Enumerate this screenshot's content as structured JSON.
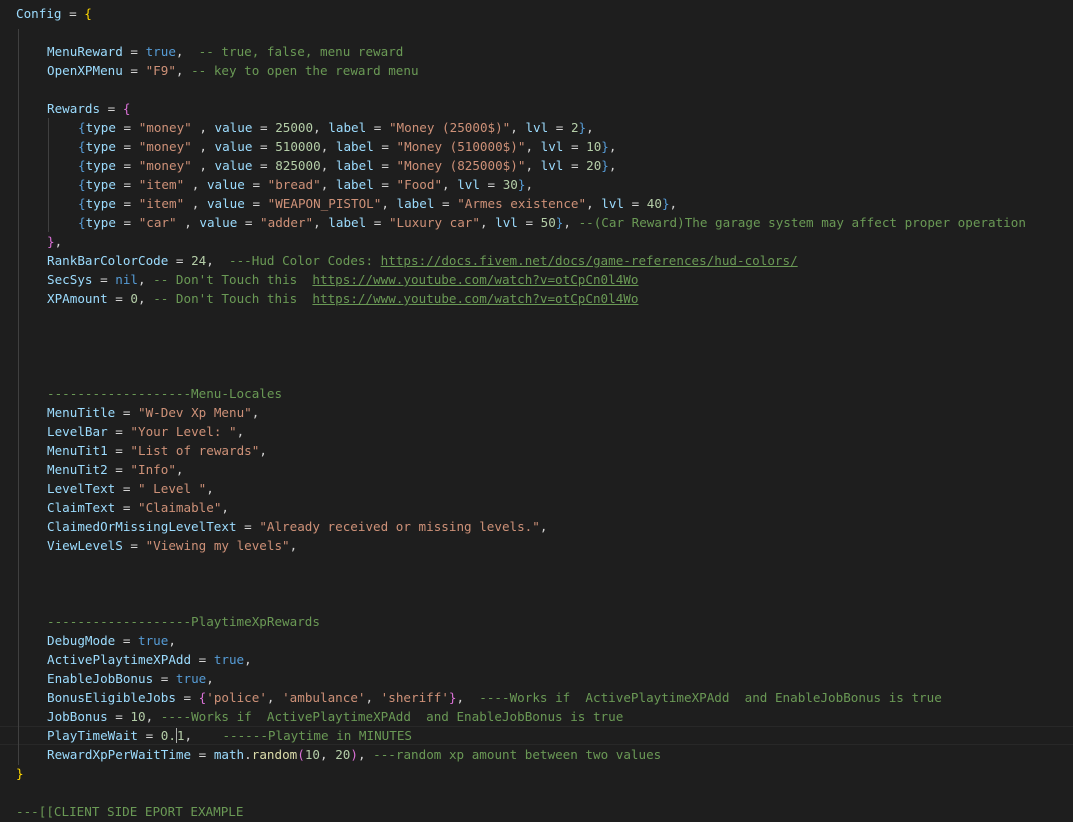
{
  "editor": {
    "lines": [
      {
        "indent": 0,
        "tokens": [
          [
            "k",
            "Config"
          ],
          [
            "p",
            " = "
          ],
          [
            "y",
            "{"
          ]
        ]
      },
      {
        "indent": 0,
        "tokens": []
      },
      {
        "indent": 1,
        "tokens": [
          [
            "k",
            "MenuReward"
          ],
          [
            "p",
            " = "
          ],
          [
            "b",
            "true"
          ],
          [
            "p",
            ",  "
          ],
          [
            "c",
            "-- true, false, menu reward"
          ]
        ]
      },
      {
        "indent": 1,
        "tokens": [
          [
            "k",
            "OpenXPMenu"
          ],
          [
            "p",
            " = "
          ],
          [
            "s",
            "\"F9\""
          ],
          [
            "p",
            ", "
          ],
          [
            "c",
            "-- key to open the reward menu"
          ]
        ]
      },
      {
        "indent": 0,
        "tokens": []
      },
      {
        "indent": 1,
        "tokens": [
          [
            "k",
            "Rewards"
          ],
          [
            "p",
            " = "
          ],
          [
            "m",
            "{"
          ]
        ]
      },
      {
        "indent": 2,
        "tokens": [
          [
            "b",
            "{"
          ],
          [
            "k",
            "type"
          ],
          [
            "p",
            " = "
          ],
          [
            "s",
            "\"money\""
          ],
          [
            "p",
            " , "
          ],
          [
            "k",
            "value"
          ],
          [
            "p",
            " = "
          ],
          [
            "n",
            "25000"
          ],
          [
            "p",
            ", "
          ],
          [
            "k",
            "label"
          ],
          [
            "p",
            " = "
          ],
          [
            "s",
            "\"Money (25000$)\""
          ],
          [
            "p",
            ", "
          ],
          [
            "k",
            "lvl"
          ],
          [
            "p",
            " = "
          ],
          [
            "n",
            "2"
          ],
          [
            "b",
            "}"
          ],
          [
            "p",
            ","
          ]
        ]
      },
      {
        "indent": 2,
        "tokens": [
          [
            "b",
            "{"
          ],
          [
            "k",
            "type"
          ],
          [
            "p",
            " = "
          ],
          [
            "s",
            "\"money\""
          ],
          [
            "p",
            " , "
          ],
          [
            "k",
            "value"
          ],
          [
            "p",
            " = "
          ],
          [
            "n",
            "510000"
          ],
          [
            "p",
            ", "
          ],
          [
            "k",
            "label"
          ],
          [
            "p",
            " = "
          ],
          [
            "s",
            "\"Money (510000$)\""
          ],
          [
            "p",
            ", "
          ],
          [
            "k",
            "lvl"
          ],
          [
            "p",
            " = "
          ],
          [
            "n",
            "10"
          ],
          [
            "b",
            "}"
          ],
          [
            "p",
            ","
          ]
        ]
      },
      {
        "indent": 2,
        "tokens": [
          [
            "b",
            "{"
          ],
          [
            "k",
            "type"
          ],
          [
            "p",
            " = "
          ],
          [
            "s",
            "\"money\""
          ],
          [
            "p",
            " , "
          ],
          [
            "k",
            "value"
          ],
          [
            "p",
            " = "
          ],
          [
            "n",
            "825000"
          ],
          [
            "p",
            ", "
          ],
          [
            "k",
            "label"
          ],
          [
            "p",
            " = "
          ],
          [
            "s",
            "\"Money (825000$)\""
          ],
          [
            "p",
            ", "
          ],
          [
            "k",
            "lvl"
          ],
          [
            "p",
            " = "
          ],
          [
            "n",
            "20"
          ],
          [
            "b",
            "}"
          ],
          [
            "p",
            ","
          ]
        ]
      },
      {
        "indent": 2,
        "tokens": [
          [
            "b",
            "{"
          ],
          [
            "k",
            "type"
          ],
          [
            "p",
            " = "
          ],
          [
            "s",
            "\"item\""
          ],
          [
            "p",
            " , "
          ],
          [
            "k",
            "value"
          ],
          [
            "p",
            " = "
          ],
          [
            "s",
            "\"bread\""
          ],
          [
            "p",
            ", "
          ],
          [
            "k",
            "label"
          ],
          [
            "p",
            " = "
          ],
          [
            "s",
            "\"Food\""
          ],
          [
            "p",
            ", "
          ],
          [
            "k",
            "lvl"
          ],
          [
            "p",
            " = "
          ],
          [
            "n",
            "30"
          ],
          [
            "b",
            "}"
          ],
          [
            "p",
            ","
          ]
        ]
      },
      {
        "indent": 2,
        "tokens": [
          [
            "b",
            "{"
          ],
          [
            "k",
            "type"
          ],
          [
            "p",
            " = "
          ],
          [
            "s",
            "\"item\""
          ],
          [
            "p",
            " , "
          ],
          [
            "k",
            "value"
          ],
          [
            "p",
            " = "
          ],
          [
            "s",
            "\"WEAPON_PISTOL\""
          ],
          [
            "p",
            ", "
          ],
          [
            "k",
            "label"
          ],
          [
            "p",
            " = "
          ],
          [
            "s",
            "\"Armes existence\""
          ],
          [
            "p",
            ", "
          ],
          [
            "k",
            "lvl"
          ],
          [
            "p",
            " = "
          ],
          [
            "n",
            "40"
          ],
          [
            "b",
            "}"
          ],
          [
            "p",
            ","
          ]
        ]
      },
      {
        "indent": 2,
        "tokens": [
          [
            "b",
            "{"
          ],
          [
            "k",
            "type"
          ],
          [
            "p",
            " = "
          ],
          [
            "s",
            "\"car\""
          ],
          [
            "p",
            " , "
          ],
          [
            "k",
            "value"
          ],
          [
            "p",
            " = "
          ],
          [
            "s",
            "\"adder\""
          ],
          [
            "p",
            ", "
          ],
          [
            "k",
            "label"
          ],
          [
            "p",
            " = "
          ],
          [
            "s",
            "\"Luxury car\""
          ],
          [
            "p",
            ", "
          ],
          [
            "k",
            "lvl"
          ],
          [
            "p",
            " = "
          ],
          [
            "n",
            "50"
          ],
          [
            "b",
            "}"
          ],
          [
            "p",
            ", "
          ],
          [
            "c",
            "--(Car Reward)The garage system may affect proper operation"
          ]
        ]
      },
      {
        "indent": 1,
        "tokens": [
          [
            "m",
            "}"
          ],
          [
            "p",
            ","
          ]
        ]
      },
      {
        "indent": 1,
        "tokens": [
          [
            "k",
            "RankBarColorCode"
          ],
          [
            "p",
            " = "
          ],
          [
            "n",
            "24"
          ],
          [
            "p",
            ",  "
          ],
          [
            "c",
            "---Hud Color Codes: "
          ],
          [
            "u",
            "https://docs.fivem.net/docs/game-references/hud-colors/"
          ]
        ]
      },
      {
        "indent": 1,
        "tokens": [
          [
            "k",
            "SecSys"
          ],
          [
            "p",
            " = "
          ],
          [
            "b",
            "nil"
          ],
          [
            "p",
            ", "
          ],
          [
            "c",
            "-- Don't Touch this  "
          ],
          [
            "u",
            "https://www.youtube.com/watch?v=otCpCn0l4Wo"
          ]
        ]
      },
      {
        "indent": 1,
        "tokens": [
          [
            "k",
            "XPAmount"
          ],
          [
            "p",
            " = "
          ],
          [
            "n",
            "0"
          ],
          [
            "p",
            ", "
          ],
          [
            "c",
            "-- Don't Touch this  "
          ],
          [
            "u",
            "https://www.youtube.com/watch?v=otCpCn0l4Wo"
          ]
        ]
      },
      {
        "indent": 0,
        "tokens": []
      },
      {
        "indent": 0,
        "tokens": []
      },
      {
        "indent": 0,
        "tokens": []
      },
      {
        "indent": 0,
        "tokens": []
      },
      {
        "indent": 1,
        "tokens": [
          [
            "c",
            "-------------------Menu-Locales"
          ]
        ]
      },
      {
        "indent": 1,
        "tokens": [
          [
            "k",
            "MenuTitle"
          ],
          [
            "p",
            " = "
          ],
          [
            "s",
            "\"W-Dev Xp Menu\""
          ],
          [
            "p",
            ","
          ]
        ]
      },
      {
        "indent": 1,
        "tokens": [
          [
            "k",
            "LevelBar"
          ],
          [
            "p",
            " = "
          ],
          [
            "s",
            "\"Your Level: \""
          ],
          [
            "p",
            ","
          ]
        ]
      },
      {
        "indent": 1,
        "tokens": [
          [
            "k",
            "MenuTit1"
          ],
          [
            "p",
            " = "
          ],
          [
            "s",
            "\"List of rewards\""
          ],
          [
            "p",
            ","
          ]
        ]
      },
      {
        "indent": 1,
        "tokens": [
          [
            "k",
            "MenuTit2"
          ],
          [
            "p",
            " = "
          ],
          [
            "s",
            "\"Info\""
          ],
          [
            "p",
            ","
          ]
        ]
      },
      {
        "indent": 1,
        "tokens": [
          [
            "k",
            "LevelText"
          ],
          [
            "p",
            " = "
          ],
          [
            "s",
            "\" Level \""
          ],
          [
            "p",
            ","
          ]
        ]
      },
      {
        "indent": 1,
        "tokens": [
          [
            "k",
            "ClaimText"
          ],
          [
            "p",
            " = "
          ],
          [
            "s",
            "\"Claimable\""
          ],
          [
            "p",
            ","
          ]
        ]
      },
      {
        "indent": 1,
        "tokens": [
          [
            "k",
            "ClaimedOrMissingLevelText"
          ],
          [
            "p",
            " = "
          ],
          [
            "s",
            "\"Already received or missing levels.\""
          ],
          [
            "p",
            ","
          ]
        ]
      },
      {
        "indent": 1,
        "tokens": [
          [
            "k",
            "ViewLevelS"
          ],
          [
            "p",
            " = "
          ],
          [
            "s",
            "\"Viewing my levels\""
          ],
          [
            "p",
            ","
          ]
        ]
      },
      {
        "indent": 0,
        "tokens": []
      },
      {
        "indent": 0,
        "tokens": []
      },
      {
        "indent": 0,
        "tokens": []
      },
      {
        "indent": 1,
        "tokens": [
          [
            "c",
            "-------------------PlaytimeXpRewards"
          ]
        ]
      },
      {
        "indent": 1,
        "tokens": [
          [
            "k",
            "DebugMode"
          ],
          [
            "p",
            " = "
          ],
          [
            "b",
            "true"
          ],
          [
            "p",
            ","
          ]
        ]
      },
      {
        "indent": 1,
        "tokens": [
          [
            "k",
            "ActivePlaytimeXPAdd"
          ],
          [
            "p",
            " = "
          ],
          [
            "b",
            "true"
          ],
          [
            "p",
            ","
          ]
        ]
      },
      {
        "indent": 1,
        "tokens": [
          [
            "k",
            "EnableJobBonus"
          ],
          [
            "p",
            " = "
          ],
          [
            "b",
            "true"
          ],
          [
            "p",
            ","
          ]
        ]
      },
      {
        "indent": 1,
        "tokens": [
          [
            "k",
            "BonusEligibleJobs"
          ],
          [
            "p",
            " = "
          ],
          [
            "m",
            "{"
          ],
          [
            "s",
            "'police'"
          ],
          [
            "p",
            ", "
          ],
          [
            "s",
            "'ambulance'"
          ],
          [
            "p",
            ", "
          ],
          [
            "s",
            "'sheriff'"
          ],
          [
            "m",
            "}"
          ],
          [
            "p",
            ",  "
          ],
          [
            "c",
            "----Works if  ActivePlaytimeXPAdd  and EnableJobBonus is true"
          ]
        ]
      },
      {
        "indent": 1,
        "tokens": [
          [
            "k",
            "JobBonus"
          ],
          [
            "p",
            " = "
          ],
          [
            "n",
            "10"
          ],
          [
            "p",
            ", "
          ],
          [
            "c",
            "----Works if  ActivePlaytimeXPAdd  and EnableJobBonus is true"
          ]
        ]
      },
      {
        "indent": 1,
        "tokens": [
          [
            "k",
            "PlayTimeWait"
          ],
          [
            "p",
            " = "
          ],
          [
            "n",
            "0."
          ],
          [
            "cursor",
            ""
          ],
          [
            "n",
            "1"
          ],
          [
            "p",
            ",    "
          ],
          [
            "c",
            "------Playtime in MINUTES"
          ]
        ]
      },
      {
        "indent": 1,
        "tokens": [
          [
            "k",
            "RewardXpPerWaitTime"
          ],
          [
            "p",
            " = "
          ],
          [
            "k",
            "math"
          ],
          [
            "p",
            "."
          ],
          [
            "f",
            "random"
          ],
          [
            "m",
            "("
          ],
          [
            "n",
            "10"
          ],
          [
            "p",
            ", "
          ],
          [
            "n",
            "20"
          ],
          [
            "m",
            ")"
          ],
          [
            "p",
            ", "
          ],
          [
            "c",
            "---random xp amount between two values"
          ]
        ]
      },
      {
        "indent": 0,
        "tokens": [
          [
            "y",
            "}"
          ]
        ]
      },
      {
        "indent": 0,
        "tokens": []
      },
      {
        "indent": 0,
        "tokens": [
          [
            "c",
            "---[[CLIENT SIDE EPORT EXAMPLE"
          ]
        ]
      }
    ]
  }
}
